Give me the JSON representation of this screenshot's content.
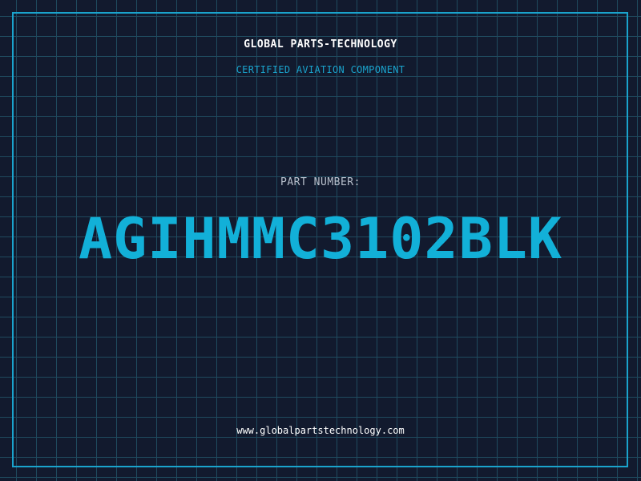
{
  "header": {
    "company": "GLOBAL PARTS-TECHNOLOGY",
    "tagline": "CERTIFIED AVIATION COMPONENT"
  },
  "part": {
    "label": "PART NUMBER:",
    "number": "AGIHMMC3102BLK"
  },
  "footer": {
    "url": "www.globalpartstechnology.com"
  },
  "colors": {
    "background": "#121a2e",
    "grid": "#1f4a5e",
    "accent": "#1aa3cc",
    "part_number": "#12b0d8",
    "text": "#ffffff"
  }
}
